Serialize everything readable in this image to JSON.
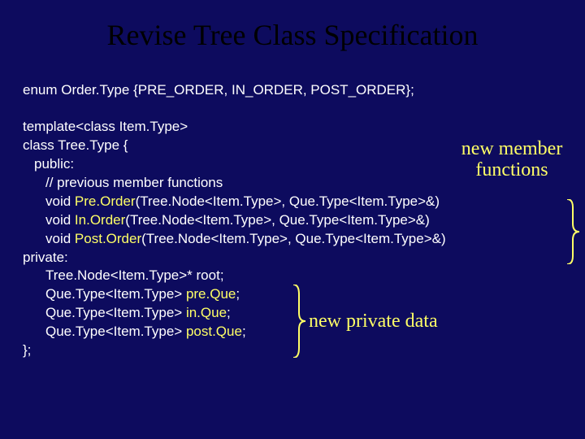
{
  "title": "Revise Tree Class Specification",
  "enum_line": "enum Order.Type {PRE_ORDER, IN_ORDER, POST_ORDER};",
  "code": {
    "l1": "template<class Item.Type>",
    "l2": "class Tree.Type {",
    "l3": "public:",
    "l4": "// previous member functions",
    "l5a": "void ",
    "l5b": "Pre.Order",
    "l5c": "(Tree.Node<Item.Type>, Que.Type<Item.Type>&)",
    "l6a": "void ",
    "l6b": "In.Order",
    "l6c": "(Tree.Node<Item.Type>, Que.Type<Item.Type>&)",
    "l7a": "void ",
    "l7b": "Post.Order",
    "l7c": "(Tree.Node<Item.Type>, Que.Type<Item.Type>&)",
    "l8": "private:",
    "l9": "Tree.Node<Item.Type>* root;",
    "l10a": "Que.Type<Item.Type> ",
    "l10b": "pre.Que",
    "l10c": ";",
    "l11a": "Que.Type<Item.Type> ",
    "l11b": "in.Que",
    "l11c": ";",
    "l12a": "Que.Type<Item.Type> ",
    "l12b": "post.Que",
    "l12c": ";",
    "l13": "};"
  },
  "annotations": {
    "members_l1": "new member",
    "members_l2": "functions",
    "private": "new private data"
  }
}
